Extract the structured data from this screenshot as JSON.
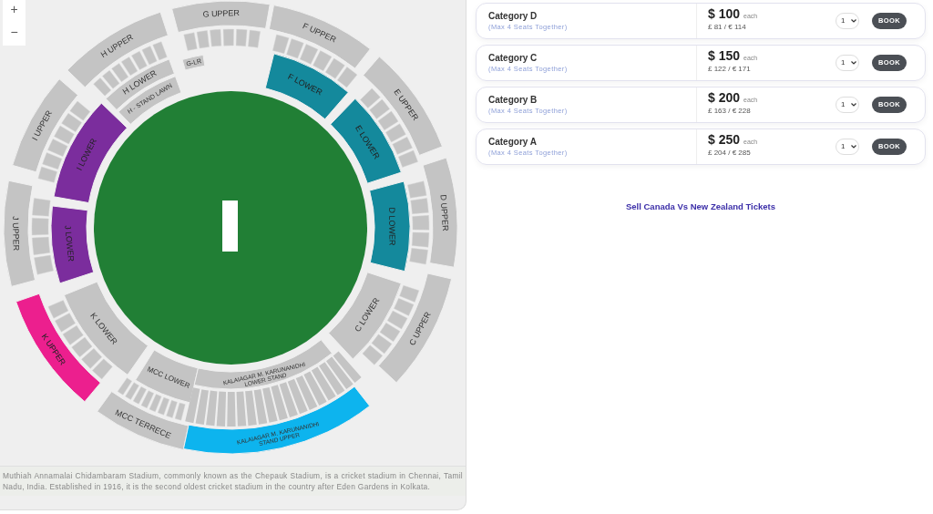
{
  "zoom": {
    "in": "+",
    "out": "−"
  },
  "sections": [
    {
      "label": [
        "G UPPER"
      ],
      "color": "#c4c4c4"
    },
    {
      "label": [
        "H UPPER"
      ],
      "color": "#c4c4c4"
    },
    {
      "label": [
        "H LOWER"
      ],
      "color": "#c4c4c4"
    },
    {
      "label": [
        "H - STAND LAWN"
      ],
      "color": "#c4c4c4"
    },
    {
      "label": [
        "I UPPER"
      ],
      "color": "#c4c4c4"
    },
    {
      "label": [
        "I LOWER"
      ],
      "color": "#7b2d9d"
    },
    {
      "label": [
        "J UPPER"
      ],
      "color": "#c4c4c4"
    },
    {
      "label": [
        "J LOWER"
      ],
      "color": "#7b2d9d"
    },
    {
      "label": [
        "K UPPER"
      ],
      "color": "#ec1f8e"
    },
    {
      "label": [
        "K LOWER"
      ],
      "color": "#c4c4c4"
    },
    {
      "label": [
        "MCC TERRECE"
      ],
      "color": "#c4c4c4"
    },
    {
      "label": [
        "MCC LOWER"
      ],
      "color": "#c4c4c4"
    },
    {
      "label": [
        "KALAIAGAR M. KARUNANIDHI",
        "LOWER STAND"
      ],
      "color": "#c4c4c4"
    },
    {
      "label": [
        "KALAIAGAR M. KARUNANIDHI",
        "STAND UPPER"
      ],
      "color": "#0db4ee"
    },
    {
      "label": [
        "C UPPER"
      ],
      "color": "#c4c4c4"
    },
    {
      "label": [
        "C LOWER"
      ],
      "color": "#c4c4c4"
    },
    {
      "label": [
        "D UPPER"
      ],
      "color": "#c4c4c4"
    },
    {
      "label": [
        "D LOWER"
      ],
      "color": "#14899c"
    },
    {
      "label": [
        "E UPPER"
      ],
      "color": "#c4c4c4"
    },
    {
      "label": [
        "E LOWER"
      ],
      "color": "#14899c"
    },
    {
      "label": [
        "F UPPER"
      ],
      "color": "#c4c4c4"
    },
    {
      "label": [
        "F LOWER"
      ],
      "color": "#14899c"
    },
    {
      "label": [
        "G-LR"
      ],
      "color": "#c4c4c4"
    }
  ],
  "description": "Muthiah Annamalai Chidambaram Stadium, commonly known as the Chepauk Stadium, is a cricket stadium in Chennai, Tamil Nadu, India. Established in 1916, it is the second oldest cricket stadium in the country after Eden Gardens in Kolkata.",
  "categories": [
    {
      "name": "Category D",
      "note": "(Max 4 Seats Together)",
      "price": "$ 100",
      "unit": "each",
      "alt_prices": "£ 81  /  € 114",
      "quantity": "1",
      "button": "BOOK"
    },
    {
      "name": "Category C",
      "note": "(Max 4 Seats Together)",
      "price": "$ 150",
      "unit": "each",
      "alt_prices": "£ 122  /  € 171",
      "quantity": "1",
      "button": "BOOK"
    },
    {
      "name": "Category B",
      "note": "(Max 4 Seats Together)",
      "price": "$ 200",
      "unit": "each",
      "alt_prices": "£ 163  /  € 228",
      "quantity": "1",
      "button": "BOOK"
    },
    {
      "name": "Category A",
      "note": "(Max 4 Seats Together)",
      "price": "$ 250",
      "unit": "each",
      "alt_prices": "£ 204  /  € 285",
      "quantity": "1",
      "button": "BOOK"
    }
  ],
  "sell_link": "Sell Canada Vs New Zealand Tickets"
}
